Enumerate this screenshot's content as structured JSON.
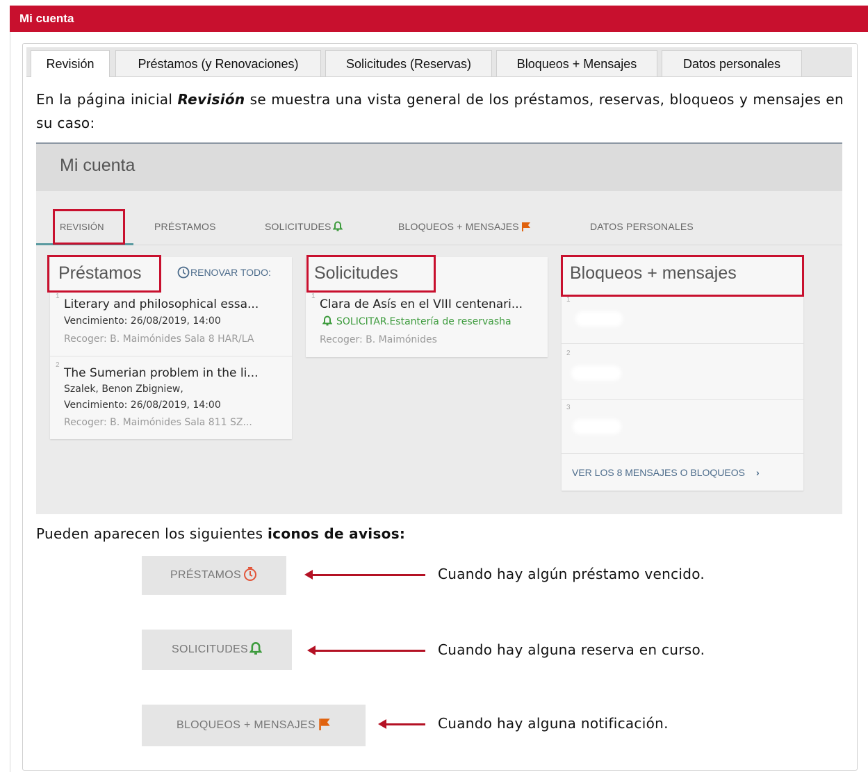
{
  "window_title": "Mi cuenta",
  "outer_tabs": [
    {
      "label": "Revisión",
      "active": true
    },
    {
      "label": "Préstamos (y Renovaciones)",
      "active": false
    },
    {
      "label": "Solicitudes (Reservas)",
      "active": false
    },
    {
      "label": "Bloqueos + Mensajes",
      "active": false
    },
    {
      "label": "Datos personales",
      "active": false
    }
  ],
  "intro": {
    "before": "En la página inicial ",
    "emphasis": "Revisión",
    "after": " se muestra una vista general de los préstamos, reservas, bloqueos y mensajes en su caso:"
  },
  "screenshot": {
    "title": "Mi cuenta",
    "tabs": [
      "REVISIÓN",
      "PRÉSTAMOS",
      "SOLICITUDES",
      "BLOQUEOS + MENSAJES",
      "DATOS PERSONALES"
    ],
    "loans": {
      "heading": "Préstamos",
      "renew_all": "RENOVAR TODO:",
      "items": [
        {
          "num": "1",
          "title": "Literary and philosophical essa...",
          "due": "Vencimiento: 26/08/2019, 14:00",
          "pickup": "Recoger: B. Maimónides Sala 8 HAR/LA"
        },
        {
          "num": "2",
          "title": "The Sumerian problem in the li...",
          "author": "Szalek, Benon Zbigniew,",
          "due": "Vencimiento: 26/08/2019, 14:00",
          "pickup": "Recoger: B. Maimónides Sala 811 SZ..."
        }
      ]
    },
    "requests": {
      "heading": "Solicitudes",
      "items": [
        {
          "num": "1",
          "title": "Clara de Asís en el VIII centenari...",
          "status": "SOLICITAR.Estantería de reservasha",
          "pickup": "Recoger: B. Maimónides"
        }
      ]
    },
    "blocks": {
      "heading": "Bloqueos + mensajes",
      "item_nums": [
        "1",
        "2",
        "3"
      ],
      "view_all": "VER LOS 8 MENSAJES O BLOQUEOS"
    }
  },
  "note": {
    "before": "Pueden aparecen  los siguientes ",
    "bold": "iconos de avisos",
    "after": ":"
  },
  "legend": [
    {
      "button": "PRÉSTAMOS",
      "icon": "clock-alert-icon",
      "text": "Cuando hay algún préstamo vencido."
    },
    {
      "button": "SOLICITUDES",
      "icon": "bell-icon",
      "text": "Cuando hay alguna reserva en curso."
    },
    {
      "button": "BLOQUEOS + MENSAJES",
      "icon": "flag-icon",
      "text": "Cuando hay alguna notificación."
    }
  ],
  "colors": {
    "title_bar": "#c8102e",
    "highlight_box": "#c8102e",
    "bell_green": "#3d9b3d",
    "clock_red": "#e2553a",
    "flag_orange": "#e0620e"
  }
}
